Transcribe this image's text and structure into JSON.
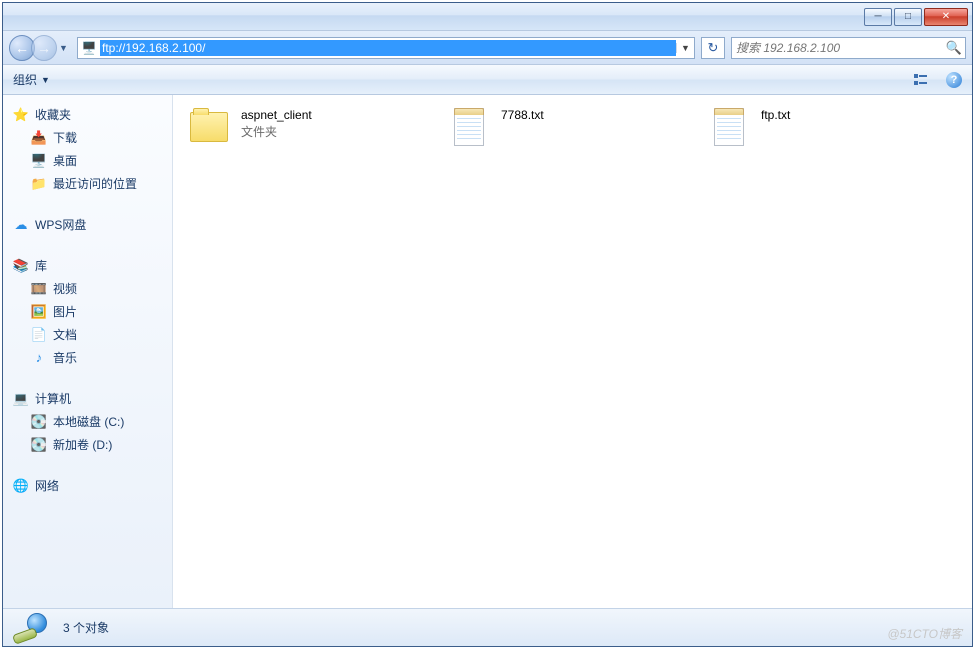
{
  "address": {
    "url": "ftp://192.168.2.100/"
  },
  "search": {
    "placeholder": "搜索 192.168.2.100"
  },
  "toolbar": {
    "organize": "组织"
  },
  "sidebar": {
    "favorites": {
      "label": "收藏夹",
      "items": [
        "下载",
        "桌面",
        "最近访问的位置"
      ]
    },
    "wps": {
      "label": "WPS网盘"
    },
    "libraries": {
      "label": "库",
      "items": [
        "视频",
        "图片",
        "文档",
        "音乐"
      ]
    },
    "computer": {
      "label": "计算机",
      "items": [
        "本地磁盘 (C:)",
        "新加卷 (D:)"
      ]
    },
    "network": {
      "label": "网络"
    }
  },
  "content": {
    "items": [
      {
        "name": "aspnet_client",
        "sub": "文件夹",
        "type": "folder"
      },
      {
        "name": "7788.txt",
        "sub": "",
        "type": "file"
      },
      {
        "name": "ftp.txt",
        "sub": "",
        "type": "file"
      }
    ]
  },
  "status": {
    "text": "3 个对象"
  },
  "watermark": "@51CTO博客"
}
